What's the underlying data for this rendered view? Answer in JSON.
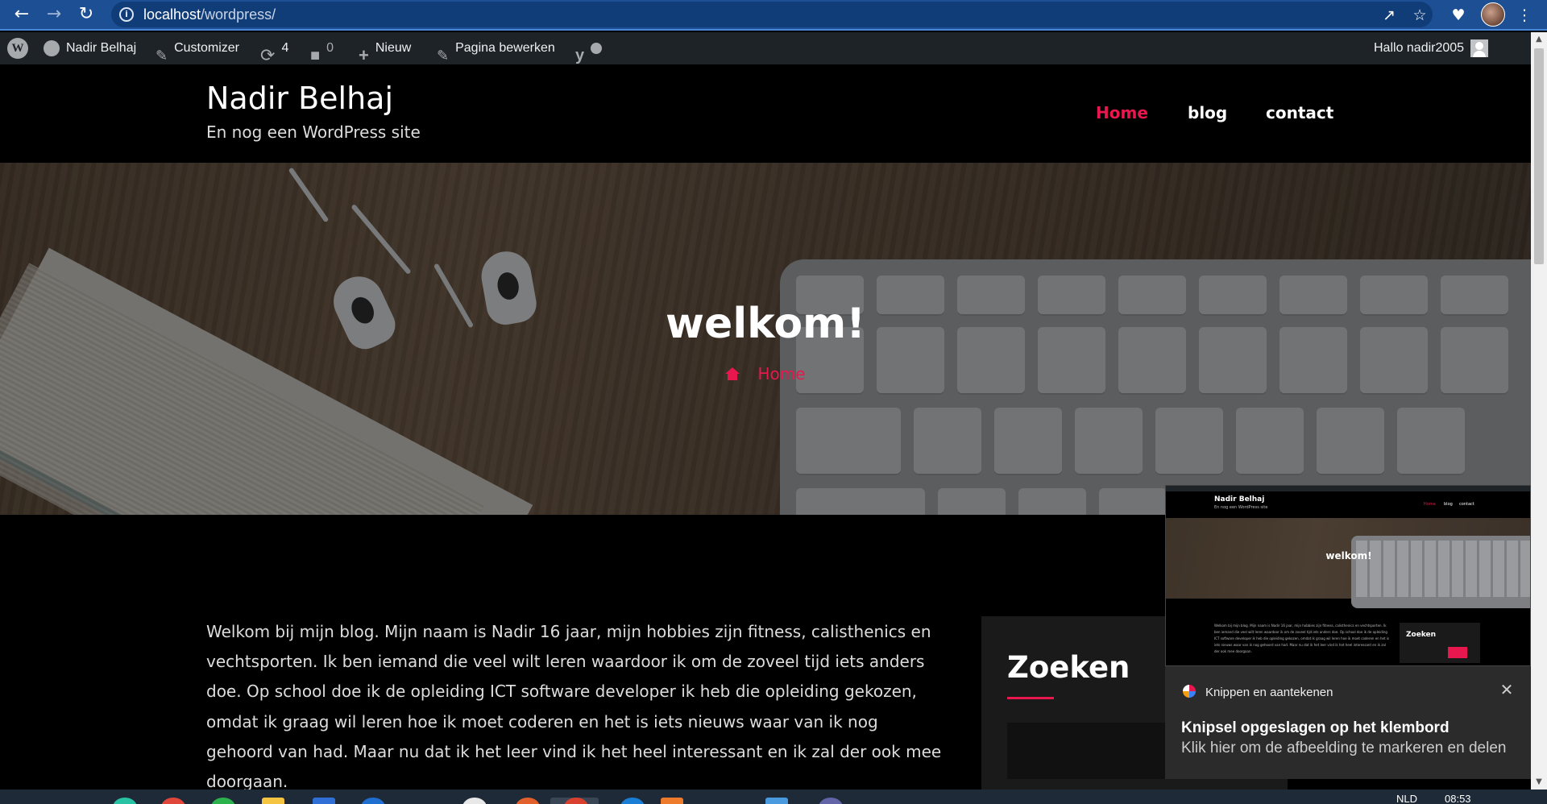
{
  "browser": {
    "url_host": "localhost",
    "url_path": "/wordpress/"
  },
  "adminbar": {
    "site_name": "Nadir Belhaj",
    "customizer": "Customizer",
    "updates_count": "4",
    "comments_count": "0",
    "new_label": "Nieuw",
    "edit_page": "Pagina bewerken",
    "greeting": "Hallo nadir2005"
  },
  "site": {
    "title": "Nadir Belhaj",
    "tagline": "En nog een WordPress site",
    "menu": [
      {
        "label": "Home",
        "active": true
      },
      {
        "label": "blog",
        "active": false
      },
      {
        "label": "contact",
        "active": false
      }
    ]
  },
  "hero": {
    "title": "welkom!",
    "breadcrumb": "Home"
  },
  "content": {
    "paragraph": "Welkom bij mijn blog. Mijn naam is Nadir 16 jaar, mijn hobbies zijn fitness, calisthenics en vechtsporten. Ik ben iemand die veel wilt leren waardoor ik om de zoveel tijd iets anders doe. Op school doe ik de opleiding ICT software developer ik heb die opleiding gekozen, omdat ik graag wil leren hoe ik moet coderen en het is iets nieuws waar van ik nog gehoord van had. Maar nu dat ik het leer vind ik het heel interessant en ik zal der ook mee doorgaan."
  },
  "sidebar": {
    "widget_title": "Zoeken"
  },
  "snip_preview": {
    "title": "Nadir Belhaj",
    "tagline": "En nog een WordPress site",
    "nav": [
      "Home",
      "blog",
      "contact"
    ],
    "hero_title": "welkom!",
    "widget_title": "Zoeken"
  },
  "toast": {
    "app_name": "Knippen en aantekenen",
    "title": "Knipsel opgeslagen op het klembord",
    "body": "Klik hier om de afbeelding te markeren en delen"
  },
  "taskbar": {
    "language": "NLD",
    "time": "08:53"
  },
  "colors": {
    "accent": "#e8174d",
    "adminbar": "#1d2327",
    "browser_chrome": "#1c4f93"
  }
}
